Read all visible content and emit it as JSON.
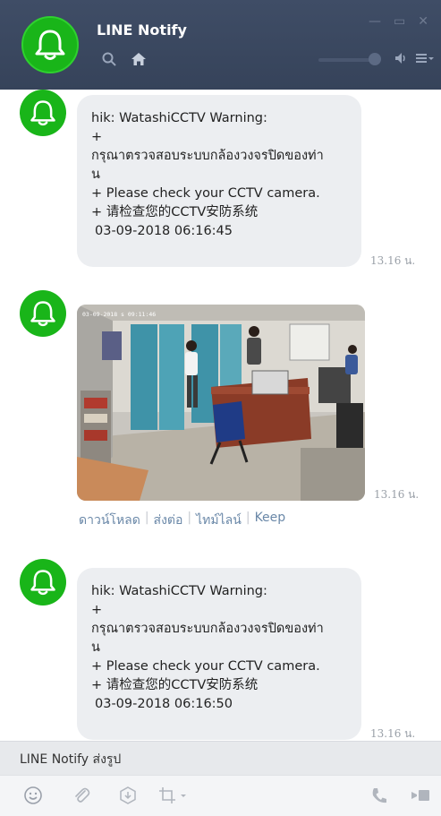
{
  "window": {
    "title": "LINE Notify"
  },
  "messages": [
    {
      "lines": [
        "hik: WatashiCCTV Warning:",
        "+",
        "กรุณาตรวจสอบระบบกล้องวงจรปิดของท่า",
        "น",
        "+ Please check your CCTV camera.",
        "+ 请检查您的CCTV安防系统",
        "03-09-2018 06:16:45"
      ],
      "time": "13.16 น."
    },
    {
      "image_caption": "03-09-2018 s 09:11:46",
      "time": "13.16 น.",
      "actions": [
        "ดาวน์โหลด",
        "ส่งต่อ",
        "ไทม์ไลน์",
        "Keep"
      ]
    },
    {
      "lines": [
        "hik: WatashiCCTV Warning:",
        "+",
        "กรุณาตรวจสอบระบบกล้องวงจรปิดของท่า",
        "น",
        "+ Please check your CCTV camera.",
        "+ 请检查您的CCTV安防系统",
        "03-09-2018 06:16:50"
      ],
      "time": "13.16 น."
    }
  ],
  "preview": {
    "text": "LINE Notify ส่งรูป"
  },
  "icons": {
    "header": [
      "bell-icon",
      "search-icon",
      "home-icon"
    ],
    "toolbar": [
      "emoji-icon",
      "attach-icon",
      "keep-icon",
      "screenshot-icon",
      "call-icon",
      "video-call-icon"
    ]
  },
  "colors": {
    "header_bg": "#3f4d66",
    "avatar_green": "#19b519",
    "bubble_bg": "#eceef1"
  }
}
